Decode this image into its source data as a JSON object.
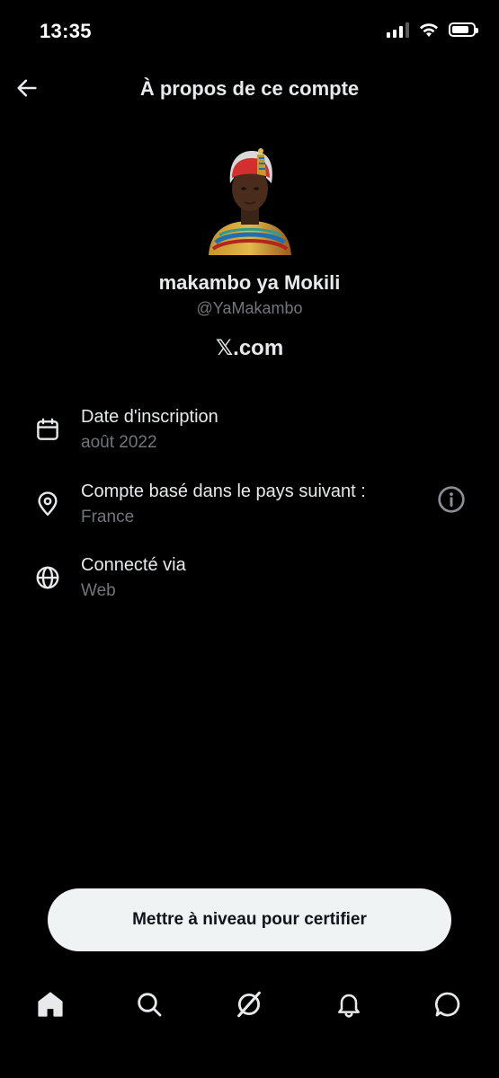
{
  "status_bar": {
    "time": "13:35"
  },
  "header": {
    "title": "À propos de ce compte"
  },
  "profile": {
    "display_name": "makambo ya Mokili",
    "handle": "@YaMakambo",
    "domain": "𝕏.com"
  },
  "info_rows": [
    {
      "icon": "calendar-icon",
      "title": "Date d'inscription",
      "value": "août 2022"
    },
    {
      "icon": "location-pin-icon",
      "title": "Compte basé dans le pays suivant :",
      "value": "France"
    },
    {
      "icon": "globe-icon",
      "title": "Connecté via",
      "value": "Web"
    }
  ],
  "upgrade_button": {
    "label": "Mettre à niveau pour certifier"
  },
  "tabs": [
    {
      "icon": "home-icon"
    },
    {
      "icon": "search-icon"
    },
    {
      "icon": "grok-icon"
    },
    {
      "icon": "bell-icon"
    },
    {
      "icon": "messages-icon"
    }
  ],
  "colors": {
    "background": "#000000",
    "text": "#e7e9ea",
    "secondary": "#71767b",
    "button_bg": "#eff3f4"
  }
}
